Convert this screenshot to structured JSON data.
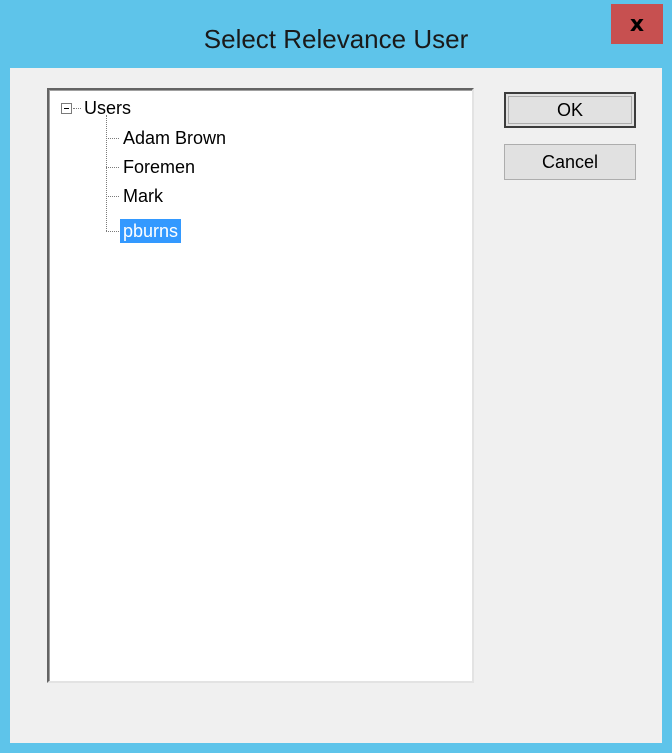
{
  "window": {
    "title": "Select Relevance User",
    "close_glyph": "x"
  },
  "tree": {
    "root": {
      "label": "Users",
      "expanded": true
    },
    "items": [
      {
        "label": "Adam Brown",
        "selected": false
      },
      {
        "label": "Foremen",
        "selected": false
      },
      {
        "label": "Mark",
        "selected": false
      },
      {
        "label": "pburns",
        "selected": true
      }
    ]
  },
  "buttons": {
    "ok_label": "OK",
    "cancel_label": "Cancel"
  },
  "colors": {
    "titlebar": "#5ec4ea",
    "close_button": "#c75050",
    "selection": "#3399ff",
    "client_background": "#f0f0f0"
  }
}
